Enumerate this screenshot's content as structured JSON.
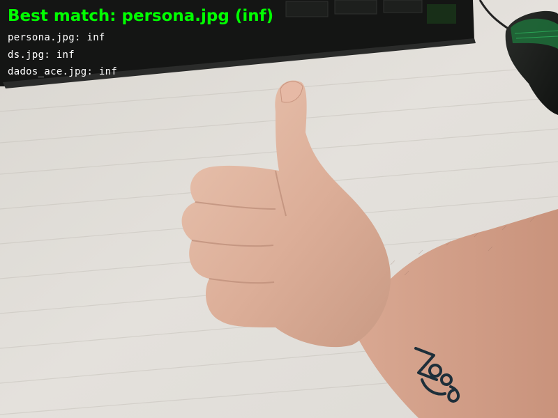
{
  "overlay": {
    "best_match": "Best match: persona.jpg (inf)",
    "scores": [
      "persona.jpg: inf",
      "ds.jpg: inf",
      "dados_ace.jpg: inf"
    ],
    "best_color": "#00ff00",
    "score_color": "#ffffff"
  },
  "scene": {
    "icons": [
      "keyboard-icon",
      "mouse-icon",
      "thumbs-up-hand-icon",
      "tattoo-icon"
    ]
  }
}
